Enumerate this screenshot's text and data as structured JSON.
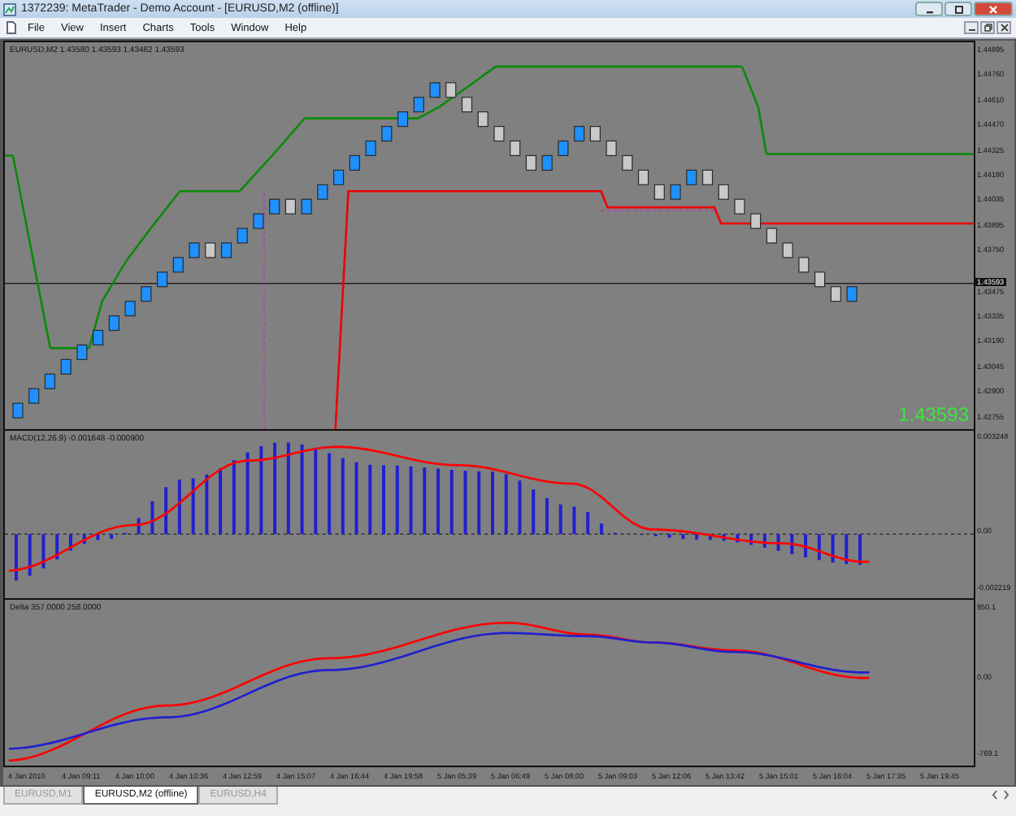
{
  "window": {
    "title": "1372239: MetaTrader - Demo Account - [EURUSD,M2 (offline)]"
  },
  "menu": [
    "File",
    "View",
    "Insert",
    "Charts",
    "Tools",
    "Window",
    "Help"
  ],
  "chart": {
    "label": "EURUSD,M2  1.43580 1.43593 1.43462 1.43593",
    "price_axis": [
      "1.44895",
      "1.44760",
      "1.44610",
      "1.44470",
      "1.44325",
      "1.44180",
      "1.44035",
      "1.43895",
      "1.43750",
      "1.43475",
      "1.43335",
      "1.43190",
      "1.43045",
      "1.42900",
      "1.42755"
    ],
    "price_tag": "1.43593",
    "last_price": "1.43593"
  },
  "macd": {
    "label": "MACD(12,26,9) -0.001648 -0.000900",
    "axis": [
      "0.003248",
      "0.00",
      "-0.002219"
    ]
  },
  "delta": {
    "label": "Delta 357.0000 258.0000",
    "axis": [
      "950.1",
      "0.00",
      "-769.1"
    ]
  },
  "time_axis": [
    "4 Jan 2010",
    "4 Jan 09:11",
    "4 Jan 10:00",
    "4 Jan 10:36",
    "4 Jan 12:59",
    "4 Jan 15:07",
    "4 Jan 16:44",
    "4 Jan 19:58",
    "5 Jan 05:39",
    "5 Jan 06:49",
    "5 Jan 08:00",
    "5 Jan 09:03",
    "5 Jan 12:06",
    "5 Jan 13:42",
    "5 Jan 15:01",
    "5 Jan 16:04",
    "5 Jan 17:35",
    "5 Jan 19:45"
  ],
  "tabs": [
    {
      "label": "EURUSD,M1",
      "selected": false
    },
    {
      "label": "EURUSD,M2 (offline)",
      "selected": true
    },
    {
      "label": "EURUSD,H4",
      "selected": false
    }
  ]
}
